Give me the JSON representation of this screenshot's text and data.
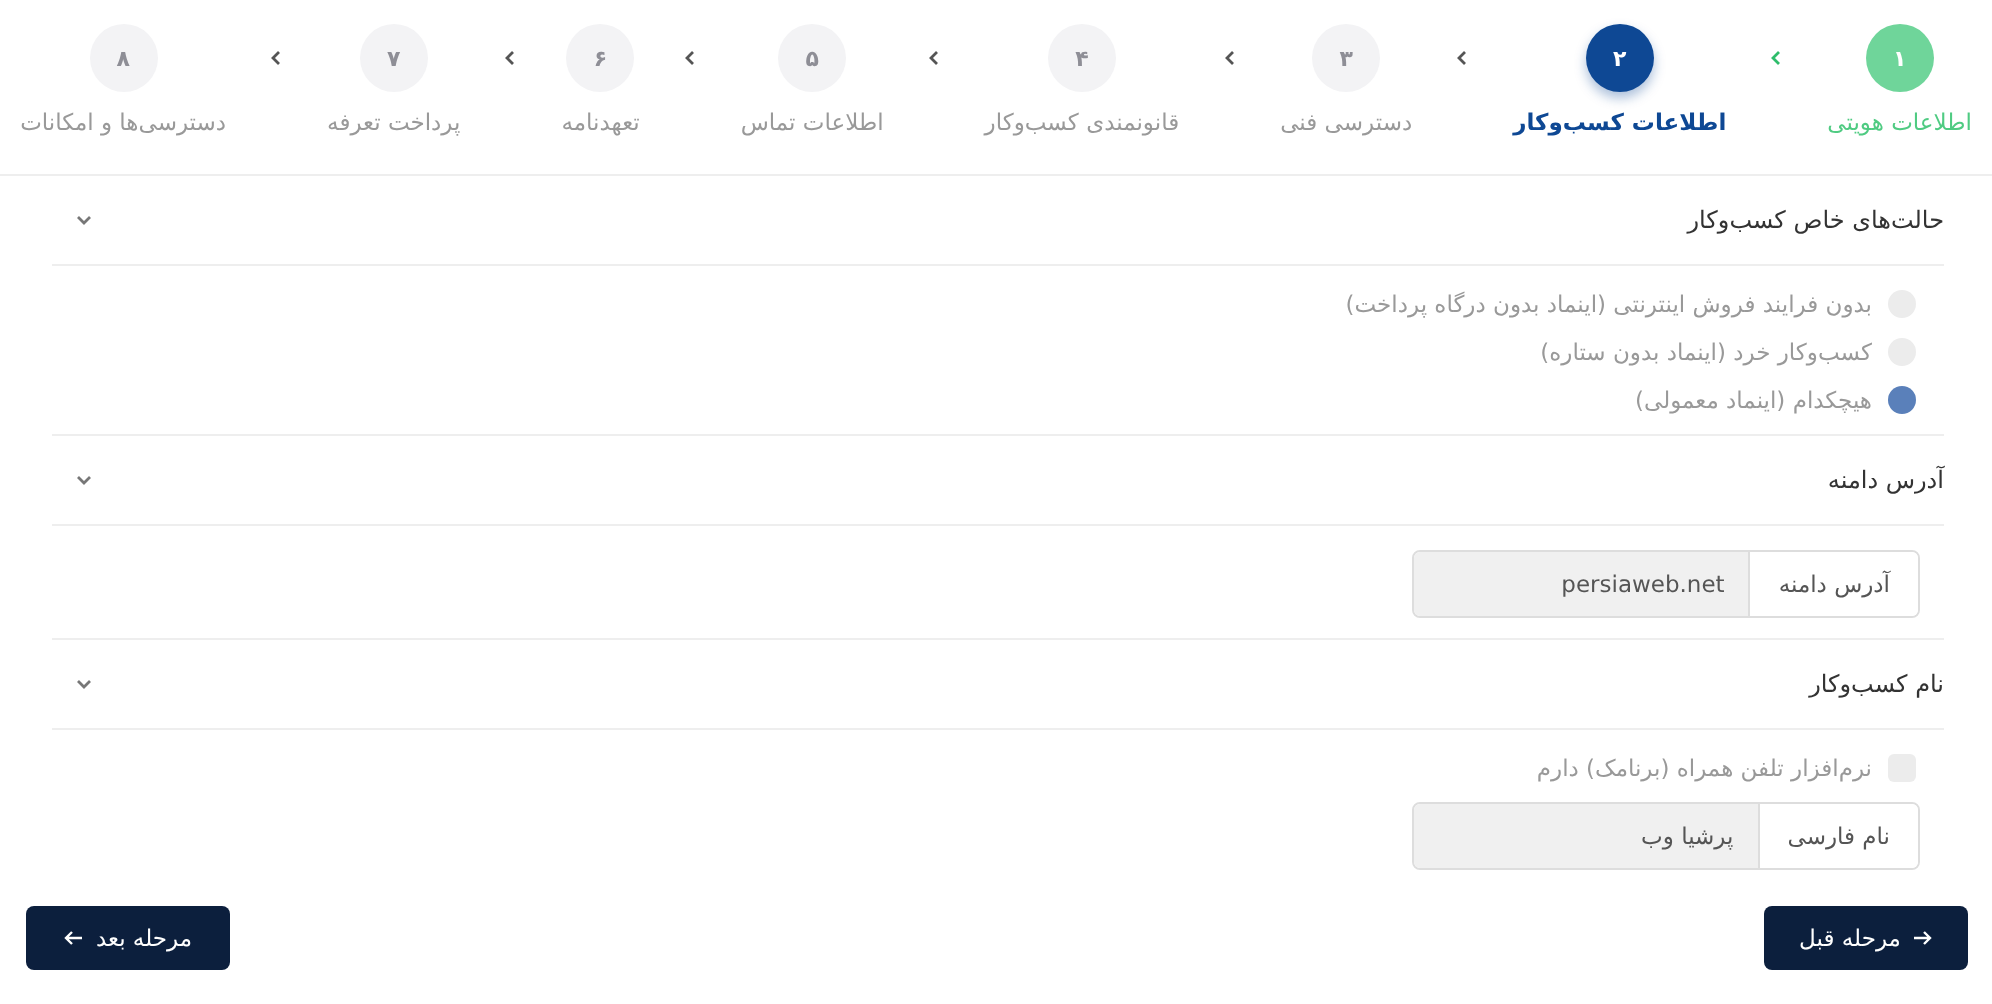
{
  "steps": [
    {
      "number": "۱",
      "label": "اطلاعات هویتی",
      "completed": true,
      "selected": false
    },
    {
      "number": "۲",
      "label": "اطلاعات کسب‌وکار",
      "completed": false,
      "selected": true
    },
    {
      "number": "۳",
      "label": "دسترسی فنی",
      "completed": false,
      "selected": false
    },
    {
      "number": "۴",
      "label": "قانونمندی کسب‌وکار",
      "completed": false,
      "selected": false
    },
    {
      "number": "۵",
      "label": "اطلاعات تماس",
      "completed": false,
      "selected": false
    },
    {
      "number": "۶",
      "label": "تعهدنامه",
      "completed": false,
      "selected": false
    },
    {
      "number": "۷",
      "label": "پرداخت تعرفه",
      "completed": false,
      "selected": false
    },
    {
      "number": "۸",
      "label": "دسترسی‌ها و امکانات",
      "completed": false,
      "selected": false
    }
  ],
  "sections": [
    {
      "title": "حالت‌های خاص کسب‌وکار",
      "expanded": true,
      "items": [
        {
          "kind": "radio",
          "label": "بدون فرایند فروش اینترنتی (اینماد بدون درگاه پرداخت)",
          "selected": false
        },
        {
          "kind": "radio",
          "label": "کسب‌وکار خرد (اینماد بدون ستاره)",
          "selected": false
        },
        {
          "kind": "radio",
          "label": "هیچکدام (اینماد معمولی)",
          "selected": true
        }
      ]
    },
    {
      "title": "آدرس دامنه",
      "expanded": true,
      "items": [
        {
          "kind": "field",
          "label": "آدرس دامنه",
          "value": "persiaweb.net"
        }
      ]
    },
    {
      "title": "نام کسب‌وکار",
      "expanded": true,
      "items": [
        {
          "kind": "checkbox",
          "label": "نرم‌افزار تلفن همراه (برنامک) دارم",
          "checked": false
        },
        {
          "kind": "field",
          "label": "نام فارسی",
          "value": "پرشیا وب"
        }
      ]
    }
  ],
  "buttons": {
    "previous": "مرحله قبل",
    "next": "مرحله بعد"
  }
}
